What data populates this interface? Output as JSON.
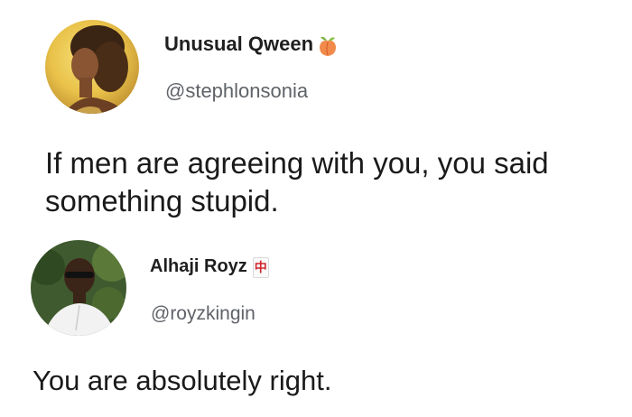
{
  "tweets": [
    {
      "display_name": "Unusual Qween",
      "name_emoji": "peach-emoji-icon",
      "handle": "@stephlonsonia",
      "text": "If men are agreeing with you, you said something stupid."
    },
    {
      "display_name": "Alhaji Royz",
      "name_emoji_glyph": "中",
      "name_emoji": "mahjong-red-dragon-icon",
      "handle": "@royzkingin",
      "text": "You are absolutely right."
    }
  ],
  "colors": {
    "background": "#ffffff",
    "text": "#1a1a1a",
    "handle": "#5f6368",
    "peach": "#f28a4b",
    "dragon_red": "#d0252b"
  }
}
